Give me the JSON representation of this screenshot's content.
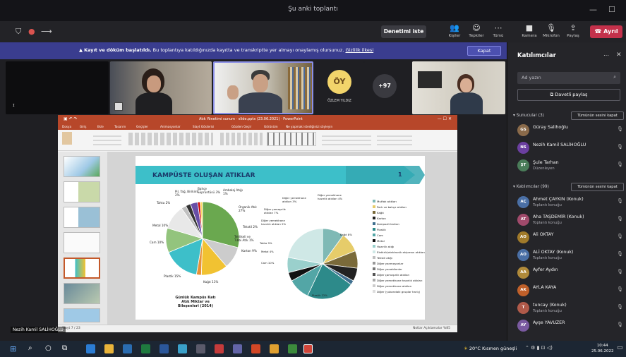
{
  "window": {
    "title": "Şu anki toplantı"
  },
  "toolbar": {
    "takeover_label": "Denetimi iste",
    "items": [
      {
        "label": "Kişiler",
        "icon": "people-icon"
      },
      {
        "label": "Tepkiler",
        "icon": "reactions-icon"
      },
      {
        "label": "Tümü",
        "icon": "more-icon"
      },
      {
        "label": "Kamera",
        "icon": "camera-icon"
      },
      {
        "label": "Mikrofon",
        "icon": "microphone-icon"
      },
      {
        "label": "Paylaş",
        "icon": "share-icon"
      }
    ],
    "leave_label": "Ayrıl"
  },
  "banner": {
    "bold": "Kayıt ve döküm başlatıldı.",
    "text": "Bu toplantıya katıldığınızda kayıtta ve transkriptte yer almayı onaylamış olursunuz.",
    "link": "Gizlilik ilkesi",
    "close_label": "Kapat"
  },
  "videos": {
    "initials": "ÖY",
    "initials_name": "ÖZLEM YILDIZ",
    "overflow_count": "+97"
  },
  "panel": {
    "title": "Katılımcılar",
    "search_placeholder": "Ad yazın",
    "share_label": "Davetli paylaş",
    "presenters_head": "Sunucular (3)",
    "presenters_btn": "Tümünün sesini kapat",
    "presenters": [
      {
        "initials": "GS",
        "name": "Güray Salihoğlu",
        "sub": "",
        "color": "#8a6a4a"
      },
      {
        "initials": "NS",
        "name": "Nezih Kamil SALİHOĞLU",
        "sub": "",
        "color": "#6b3fa0"
      },
      {
        "initials": "ŞT",
        "name": "Şule Tarhan",
        "sub": "Düzenleyen",
        "color": "#4a7c59"
      }
    ],
    "attendees_head": "Katılımcılar (99)",
    "attendees_btn": "Tümünün sesini kapat",
    "attendees": [
      {
        "initials": "AÇ",
        "name": "Ahmet ÇAYKIN (Konuk)",
        "sub": "Toplantı konuğu",
        "color": "#4a6fa5"
      },
      {
        "initials": "AT",
        "name": "Aha TAŞDEMİR (Konuk)",
        "sub": "Toplantı konuğu",
        "color": "#a04a6b"
      },
      {
        "initials": "AO",
        "name": "Ali OKTAY",
        "sub": "",
        "color": "#a07a2a"
      },
      {
        "initials": "AO",
        "name": "ALİ OKTAY (Konuk)",
        "sub": "Toplantı konuğu",
        "color": "#4a6fa5"
      },
      {
        "initials": "AA",
        "name": "Ayfer Aydın",
        "sub": "",
        "color": "#b08a3a"
      },
      {
        "initials": "AK",
        "name": "AYLA KAYA",
        "sub": "",
        "color": "#c0602a"
      },
      {
        "initials": "T",
        "name": "tuncay (Konuk)",
        "sub": "Toplantı konuğu",
        "color": "#b05a4a"
      },
      {
        "initials": "AY",
        "name": "Ayşe YAVUZER",
        "sub": "",
        "color": "#7a5aa0"
      }
    ]
  },
  "ppt": {
    "window_title": "Atık Yönetimi sunum · slide.pptx (23.06.2021) · PowerPoint",
    "tabs": [
      "Dosya",
      "Giriş",
      "Ekle",
      "Tasarım",
      "Geçişler",
      "Animasyonlar",
      "Slayt Gösterisi",
      "Gözden Geçir",
      "Görünüm",
      "Ne yapmak istediğinizi söyleyin"
    ],
    "status_left": "Slayt 7 / 23",
    "status_right": "Notlar   Açıklamalar   %85"
  },
  "slide": {
    "title": "KAMPÜSTE OLUŞAN ATIKLAR",
    "number": "1",
    "left_caption": "Günlük Kampüs Katı Atık Miktar ve Bileşenleri (2014)",
    "left_labels": [
      "Pil, Yağ, Birikinti 2%",
      "Bahçe Süprüntüsü 3%",
      "Ambalaj Atığı 1%",
      "Organik Atık 27%",
      "Tekstil 2%",
      "Metal 10%",
      "Cam 10%",
      "Plastik 15%",
      "Tahta 2%",
      "Kağıt 11%",
      "Karton 9%",
      "Tehlikeli ve Tıbbi Atık 1%"
    ],
    "right_labels": [
      "Diğer yemekhane atıkları 3%",
      "Diğer yemekhane hazırlık atıkları 4%",
      "Diğer çamaşırlık atıkları 7%",
      "Diğer yemekhane hazırlık atıkları 2%",
      "Tahta 9%",
      "Metal 4%",
      "Cam 10%",
      "Plastik 22%",
      "Kağıt 8%"
    ],
    "legend": [
      "Mutfak atıkları",
      "Park ve bahçe atıkları",
      "Kağıt",
      "Karton",
      "Kompozit karton",
      "Plastik",
      "Cam",
      "Metal",
      "Hazırlık atığı",
      "Elektrik/elektronik ekipman atıkları",
      "Tekstil atığı",
      "Diğer yanmayanlar",
      "Diğer yanabilenler",
      "Diğer çamaşırlık atıkları",
      "Diğer yemekhane hazırlık atıkları",
      "Diğer yemekhane atıkları",
      "Diğer (yukarıdaki gruplar hariç)"
    ]
  },
  "footer": {
    "speaker_name": "Nezih Kamil SALİHOĞLU",
    "weather": "20°C  Kısmen güneşli",
    "time": "10:44",
    "date": "25.06.2022"
  },
  "chart_data": [
    {
      "type": "pie",
      "title": "Günlük Kampüs Katı Atık Miktar ve Bileşenleri (2014)",
      "categories": [
        "Organik Atık",
        "Karton",
        "Kağıt",
        "Tahta",
        "Plastik",
        "Cam",
        "Metal",
        "Tekstil",
        "Pil, Yağ, Birikinti",
        "Bahçe Süprüntüsü",
        "Ambalaj Atığı",
        "Tehlikeli ve Tıbbi Atık"
      ],
      "values": [
        27,
        9,
        11,
        2,
        15,
        10,
        10,
        2,
        2,
        3,
        1,
        1
      ],
      "colors": [
        "#6aa84f",
        "#cccccc",
        "#f1c232",
        "#e69138",
        "#3dbfc9",
        "#93c47d",
        "#e8e8e8",
        "#c0c0c0",
        "#333333",
        "#674ea7",
        "#cc0000",
        "#ffd966"
      ]
    },
    {
      "type": "pie",
      "categories": [
        "Mutfak atıkları",
        "Park ve bahçe atıkları",
        "Kağıt",
        "Karton",
        "Kompozit karton",
        "Plastik",
        "Cam",
        "Metal",
        "Hazırlık atığı",
        "Diğer"
      ],
      "values": [
        10,
        9,
        8,
        6,
        2,
        22,
        10,
        4,
        7,
        22
      ],
      "colors": [
        "#7fb9b5",
        "#e6cc6a",
        "#7a6a3a",
        "#222222",
        "#3f6f8f",
        "#2d8a8a",
        "#53a6a6",
        "#111111",
        "#9ad0cc",
        "#cfe8e6"
      ]
    }
  ]
}
